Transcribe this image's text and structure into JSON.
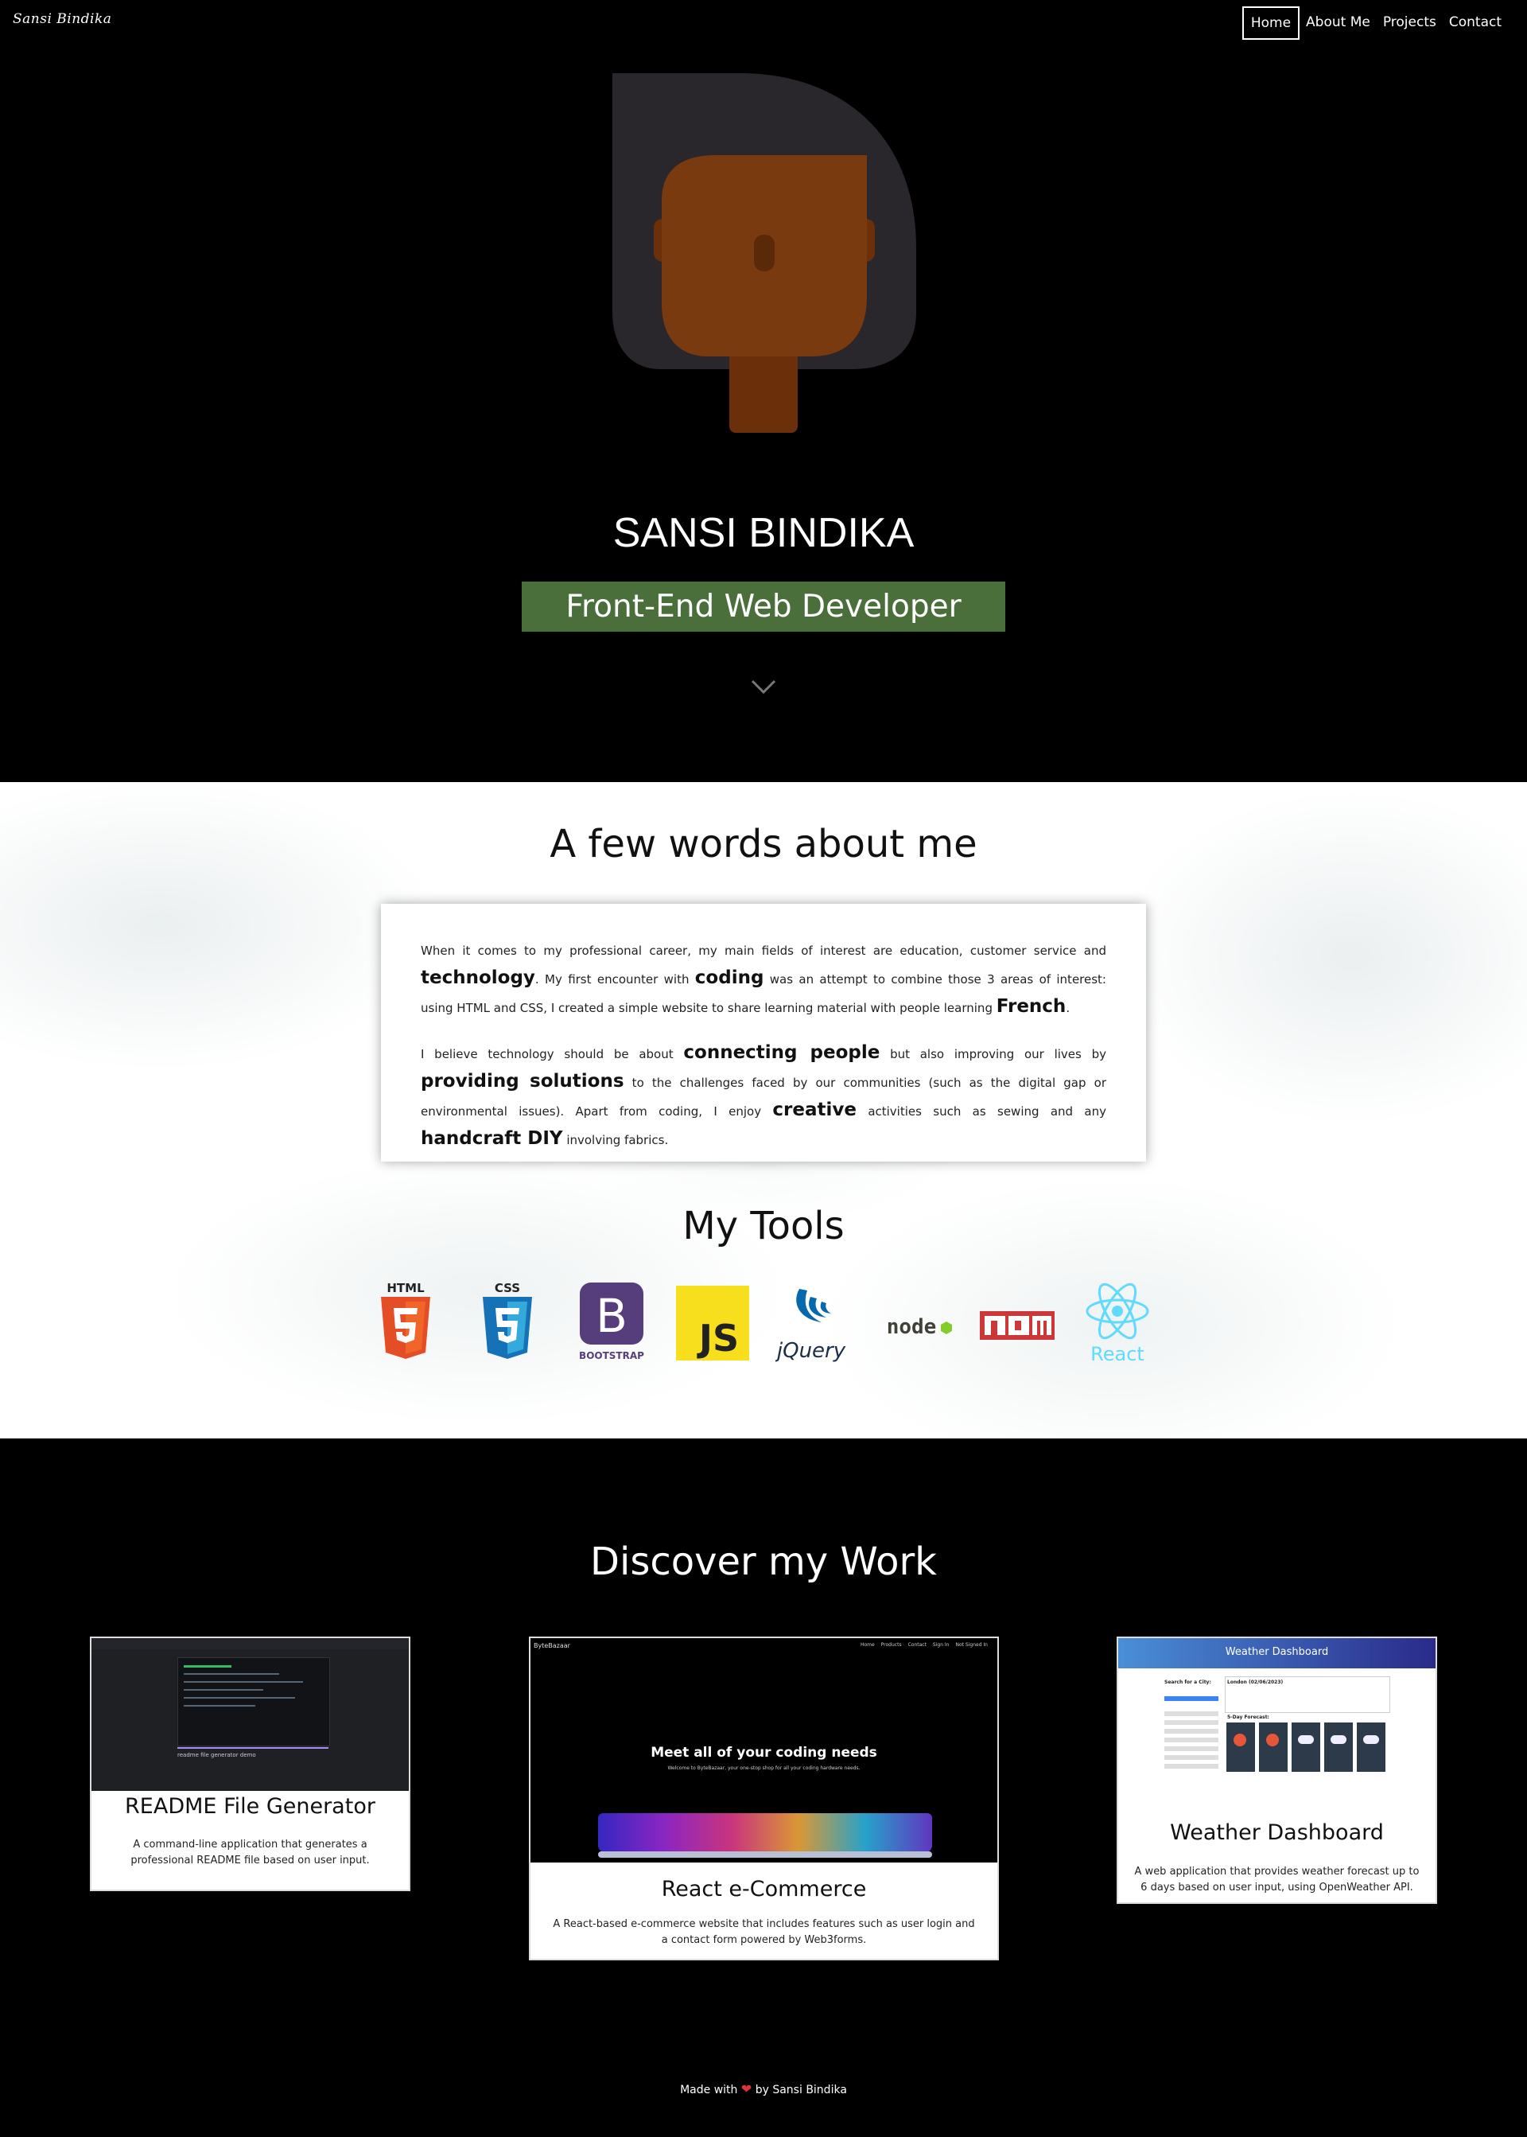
{
  "nav": {
    "brand": "Sansi Bindika",
    "links": [
      "Home",
      "About Me",
      "Projects",
      "Contact"
    ]
  },
  "hero": {
    "name": "SANSI BINDIKA",
    "title": "Front-End Web Developer",
    "title_bg": "#4a6f3a",
    "scroll_icon": "chevron-down-icon"
  },
  "about": {
    "title": "A few words about me",
    "p1": {
      "t1": "When it comes to my professional career, my main fields of interest are education, customer service and ",
      "e1": "technology",
      "t2": ". My first encounter with ",
      "e2": "coding",
      "t3": " was an attempt to combine those 3 areas of interest: using HTML and CSS, I created a simple website to share learning material with people learning ",
      "e3": "French",
      "t4": "."
    },
    "p2": {
      "t1": "I believe technology should be about ",
      "e1": "connecting people",
      "t2": " but also improving our lives by ",
      "e2": "providing solutions",
      "t3": " to the challenges faced by our communities (such as the digital gap or environmental issues). Apart from coding, I enjoy ",
      "e3": "creative",
      "t4": " activities such as sewing and any ",
      "e4": "handcraft DIY",
      "t5": " involving fabrics."
    }
  },
  "tools": {
    "title": "My Tools",
    "items": [
      {
        "name": "HTML",
        "icon": "html5-icon"
      },
      {
        "name": "CSS",
        "icon": "css3-icon"
      },
      {
        "name": "BOOTSTRAP",
        "icon": "bootstrap-icon"
      },
      {
        "name": "JS",
        "icon": "javascript-icon"
      },
      {
        "name": "jQuery",
        "icon": "jquery-icon"
      },
      {
        "name": "node",
        "icon": "nodejs-icon"
      },
      {
        "name": "npm",
        "icon": "npm-icon"
      },
      {
        "name": "React",
        "icon": "react-icon"
      }
    ]
  },
  "work": {
    "title": "Discover my Work",
    "projects": [
      {
        "title": "README File Generator",
        "desc": "A command-line application that generates a professional README file based on user input.",
        "thumb_caption": "readme file generator demo"
      },
      {
        "title": "React e-Commerce",
        "desc": "A React-based e-commerce website that includes features such as user login and a contact form powered by Web3forms.",
        "thumb_brand": "ByteBazaar",
        "thumb_nav": [
          "Home",
          "Products",
          "Contact",
          "Sign In",
          "Not Signed In"
        ],
        "thumb_heading": "Meet all of your coding needs",
        "thumb_sub": "Welcome to ByteBazaar, your one-stop shop for all your coding hardware needs."
      },
      {
        "title": "Weather Dashboard",
        "desc": "A web application that provides weather forecast up to 6 days based on user input, using OpenWeather API.",
        "thumb_header": "Weather Dashboard",
        "thumb_search": "Search for a City:",
        "thumb_city": "London (02/06/2023)",
        "thumb_forecast": "5-Day Forecast:"
      }
    ]
  },
  "footer": {
    "made": "Made with",
    "by": "by Sansi Bindika"
  }
}
